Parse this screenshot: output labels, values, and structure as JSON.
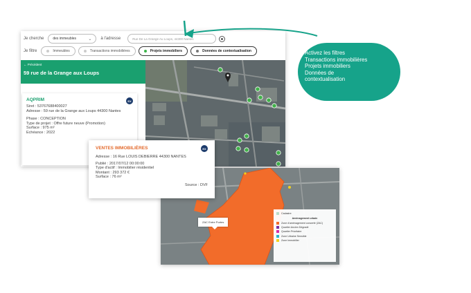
{
  "filters": {
    "search_label": "Je cherche",
    "type_select": "des immeubles",
    "address_label": "à l'adresse",
    "address_value": "Rue De La Grange Au Loups, 44300 Nantes",
    "filter_label": "Je filtre",
    "chips": [
      "Immeubles",
      "Transactions immobilières",
      "Projets immobiliers",
      "Données de contextualisation"
    ]
  },
  "panel": {
    "back_label": "Précédent",
    "address_title": "59 rue de la Grange aux Loups"
  },
  "card_project": {
    "name": "AQPRIM",
    "siret": "Siret : 53767688400027",
    "adresse": "Adresse : 59 rue de la Grange aux Loups 44300 Nantes",
    "phase": "Phase : CONCEPTION",
    "type": "Type de projet : Offre future neuve (Promotion)",
    "surface": "Surface : 975 m²",
    "echeance": "Echéance : 2022",
    "badge": "EX"
  },
  "card_sale": {
    "title": "VENTES IMMOBILIÈRES",
    "adresse": "Adresse : 16 Rue LOUIS DEBIERRE 44300 NANTES",
    "publie": "Publié : 2017/07/12 00:00:00",
    "type_actif": "Type d'actif : Immobilier résidentiel",
    "montant": "Montant : 293 372 €",
    "surface": "Surface : 76 m²",
    "source": "Source : DVF",
    "badge": "EX"
  },
  "map2": {
    "zac_label": "ZAC Entre Portes",
    "legend_top": "Cadastre",
    "legend_head": "Aménagement urbain",
    "legend_items": [
      {
        "label": "Zone d'aménagement concerté (ZAC)",
        "color": "#f26c2a"
      },
      {
        "label": "Quartier Ancien Dégradé",
        "color": "#7b2fa0"
      },
      {
        "label": "Quartier Prioritaire",
        "color": "#d62ca8"
      },
      {
        "label": "Zone Urbaine Sensible",
        "color": "#2bb5c9"
      },
      {
        "label": "Zone Immobilier",
        "color": "#f2d21e"
      }
    ]
  },
  "callout": {
    "lines": [
      "Activez les filtres",
      "Transactions immobilières",
      "Projets immobiliers",
      "Données de",
      "contextualisation"
    ]
  },
  "colors": {
    "green": "#1aa06f",
    "orange": "#e36a2c",
    "bubble": "#16a38a"
  }
}
